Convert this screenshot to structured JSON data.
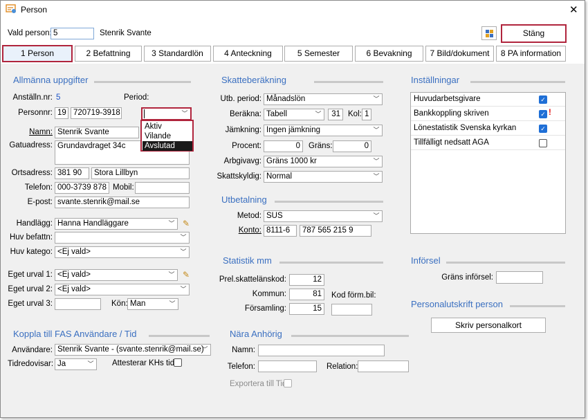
{
  "window": {
    "title": "Person",
    "close_symbol": "✕"
  },
  "top": {
    "vald_person_label": "Vald person:",
    "vald_person_value": "5",
    "person_name": "Stenrik Svante",
    "close_button": "Stäng"
  },
  "tabs": [
    {
      "label": "1 Person"
    },
    {
      "label": "2 Befattning"
    },
    {
      "label": "3 Standardlön"
    },
    {
      "label": "4 Anteckning"
    },
    {
      "label": "5 Semester"
    },
    {
      "label": "6 Bevakning"
    },
    {
      "label": "7 Bild/dokument"
    },
    {
      "label": "8 PA information"
    }
  ],
  "allmanna": {
    "title": "Allmänna uppgifter",
    "anstallningsnr_label": "Anställn.nr:",
    "anstallningsnr_value": "5",
    "period_label": "Period:",
    "period_value": "",
    "period_options": [
      "Aktiv",
      "Vilande",
      "Avslutad"
    ],
    "period_selected": "Avslutad",
    "personnr_label": "Personnr:",
    "personnr_century": "19",
    "personnr_value": "720719-3918",
    "namn_label": "Namn:",
    "namn_value": "Stenrik Svante",
    "gatuadress_label": "Gatuadress:",
    "gatuadress_value": "Grundavdraget 34c",
    "ortsadress_label": "Ortsadress:",
    "postnr_value": "381 90",
    "ort_value": "Stora Lillbyn",
    "telefon_label": "Telefon:",
    "telefon_value": "000-3739 878",
    "mobil_label": "Mobil:",
    "mobil_value": "",
    "epost_label": "E-post:",
    "epost_value": "svante.stenrik@mail.se",
    "handlagg_label": "Handlägg:",
    "handlagg_value": "Hanna Handläggare",
    "huv_befattn_label": "Huv befattn:",
    "huv_befattn_value": "",
    "huv_katego_label": "Huv katego:",
    "huv_katego_value": "<Ej vald>",
    "eget_urval1_label": "Eget urval 1:",
    "eget_urval1_value": "<Ej vald>",
    "eget_urval2_label": "Eget urval 2:",
    "eget_urval2_value": "<Ej vald>",
    "eget_urval3_label": "Eget urval 3:",
    "eget_urval3_value": "",
    "kon_label": "Kön:",
    "kon_value": "Man"
  },
  "skatt": {
    "title": "Skatteberäkning",
    "utb_period_label": "Utb. period:",
    "utb_period_value": "Månadslön",
    "berakna_label": "Beräkna:",
    "berakna_value": "Tabell",
    "tabell_value": "31",
    "kol_label": "Kol:",
    "kol_value": "1",
    "jamkning_label": "Jämkning:",
    "jamkning_value": "Ingen jämkning",
    "procent_label": "Procent:",
    "procent_value": "0",
    "grans_label": "Gräns:",
    "grans_value": "0",
    "arbgivavg_label": "Arbgivavg:",
    "arbgivavg_value": "Gräns 1000 kr",
    "skattskyldig_label": "Skattskyldig:",
    "skattskyldig_value": "Normal"
  },
  "utbetalning": {
    "title": "Utbetalning",
    "metod_label": "Metod:",
    "metod_value": "SUS",
    "konto_label": "Konto:",
    "clearing_value": "8111-6",
    "konto_value": "787 565 215 9"
  },
  "statistik": {
    "title": "Statistik mm",
    "prel_label": "Prel.skattelänskod:",
    "prel_value": "12",
    "kommun_label": "Kommun:",
    "kommun_value": "81",
    "kod_form_label": "Kod förm.bil:",
    "kod_form_value": "",
    "forsamling_label": "Församling:",
    "forsamling_value": "15"
  },
  "installningar": {
    "title": "Inställningar",
    "items": [
      {
        "label": "Huvudarbetsgivare",
        "checked": true
      },
      {
        "label": "Bankkoppling skriven",
        "checked": true,
        "warning": "!"
      },
      {
        "label": "Lönestatistik Svenska kyrkan",
        "checked": true
      },
      {
        "label": "Tillfälligt nedsatt AGA",
        "checked": false
      }
    ]
  },
  "inforsel": {
    "title": "Införsel",
    "grans_label": "Gräns införsel:",
    "grans_value": ""
  },
  "personalutskrift": {
    "title": "Personalutskrift person",
    "button": "Skriv personalkort"
  },
  "fas": {
    "title": "Koppla till FAS Användare / Tid",
    "anvandare_label": "Användare:",
    "anvandare_value": "Stenrik Svante - (svante.stenrik@mail.se)",
    "tidredovisar_label": "Tidredovisar:",
    "tidredovisar_value": "Ja",
    "attesterar_label": "Attesterar KHs tid:"
  },
  "anhorig": {
    "title": "Nära Anhörig",
    "namn_label": "Namn:",
    "namn_value": "",
    "telefon_label": "Telefon:",
    "telefon_value": "",
    "relation_label": "Relation:",
    "relation_value": "",
    "exportera_label": "Exportera till Tid:"
  },
  "colors": {
    "accent": "#3a6fc0",
    "highlight_border": "#b0243c",
    "selected_item": "#1a1a1a",
    "check": "#1f6fd6",
    "warning": "#e01010"
  }
}
